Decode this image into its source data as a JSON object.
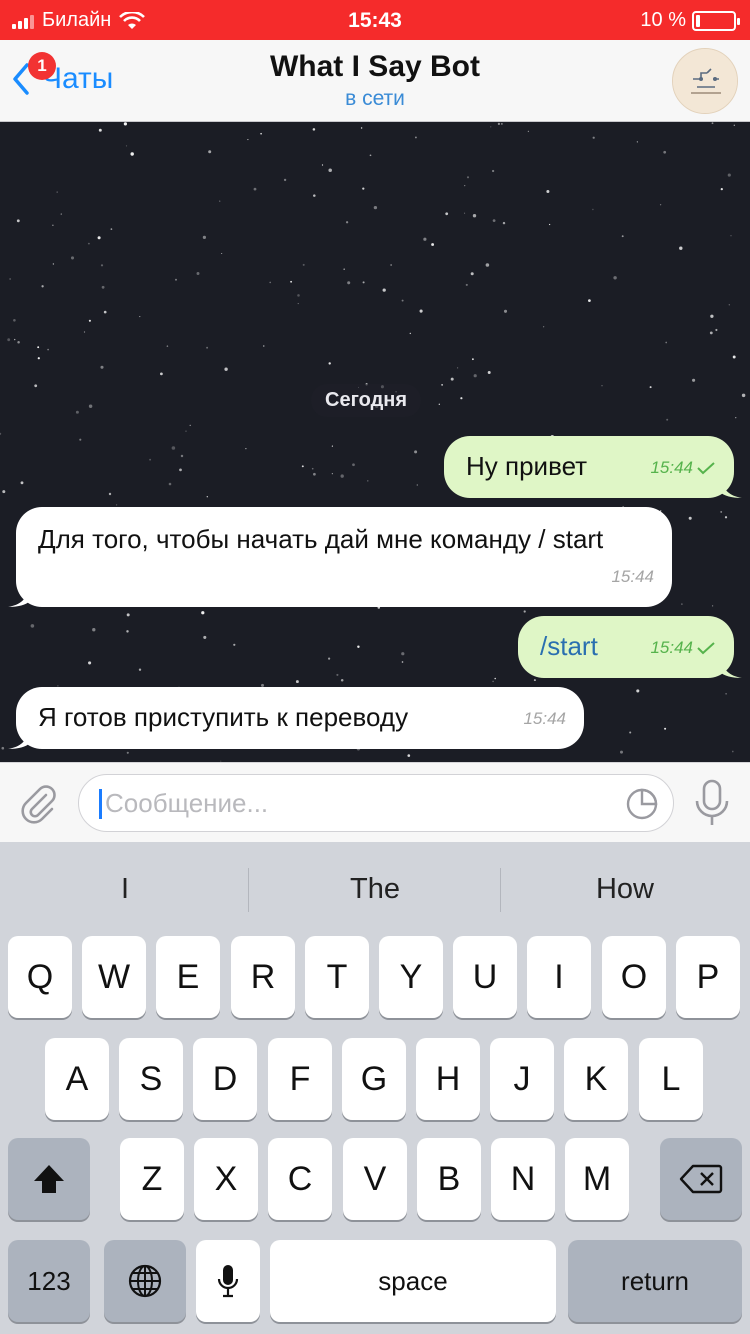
{
  "status_bar": {
    "carrier": "Билайн",
    "time": "15:43",
    "battery_text": "10 %",
    "battery_level": 0.1,
    "color": "#f52b2b"
  },
  "nav": {
    "back_label": "Чаты",
    "badge_count": "1",
    "title": "What I Say Bot",
    "subtitle": "в сети"
  },
  "chat": {
    "date_separator": "Сегодня",
    "messages": [
      {
        "direction": "outgoing",
        "text": "Ну привет",
        "time": "15:44",
        "status": "read"
      },
      {
        "direction": "incoming",
        "text": "Для того, чтобы начать дай мне команду / start",
        "time": "15:44"
      },
      {
        "direction": "outgoing",
        "text": "/start",
        "time": "15:44",
        "status": "read"
      },
      {
        "direction": "incoming",
        "text": "Я готов приступить к переводу",
        "time": "15:44"
      }
    ]
  },
  "input": {
    "placeholder": "Сообщение...",
    "value": ""
  },
  "keyboard": {
    "suggestions": [
      "I",
      "The",
      "How"
    ],
    "row1": [
      "Q",
      "W",
      "E",
      "R",
      "T",
      "Y",
      "U",
      "I",
      "O",
      "P"
    ],
    "row2": [
      "A",
      "S",
      "D",
      "F",
      "G",
      "H",
      "J",
      "K",
      "L"
    ],
    "row3": [
      "Z",
      "X",
      "C",
      "V",
      "B",
      "N",
      "M"
    ],
    "numbers_label": "123",
    "space_label": "space",
    "return_label": "return"
  },
  "colors": {
    "accent": "#1a8cff",
    "outgoing_bubble": "#dff6c6",
    "incoming_bubble": "#ffffff",
    "chat_background": "#1b1d25",
    "read_check": "#56b34c"
  }
}
